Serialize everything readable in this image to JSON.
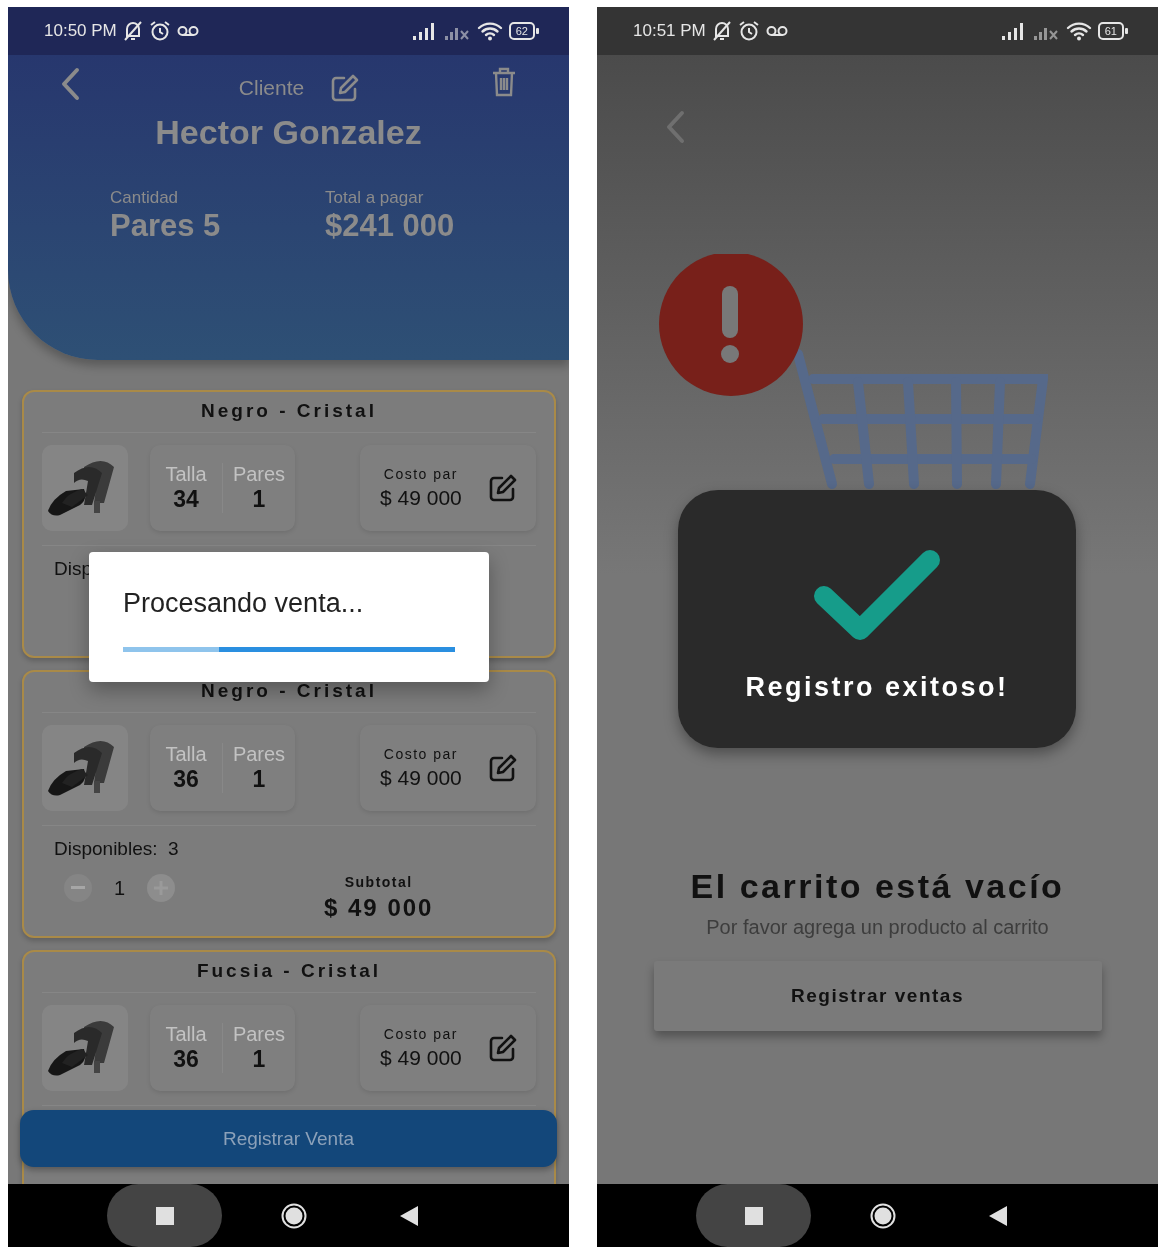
{
  "screens": [
    {
      "kind": "cart",
      "status_bar": {
        "time": "10:50 PM",
        "battery": "62"
      },
      "header": {
        "label": "Cliente",
        "customer": "Hector Gonzalez",
        "stats": [
          {
            "label": "Cantidad",
            "value": "Pares 5"
          },
          {
            "label": "Total a pagar",
            "value": "$241 000"
          }
        ]
      },
      "items": [
        {
          "title": "Negro - Cristal",
          "size_label": "Talla",
          "size": "34",
          "pairs_label": "Pares",
          "pairs": "1",
          "cost_label": "Costo par",
          "cost": "$ 49 000",
          "available": "Disp"
        },
        {
          "title": "Negro - Cristal",
          "size_label": "Talla",
          "size": "36",
          "pairs_label": "Pares",
          "pairs": "1",
          "cost_label": "Costo par",
          "cost": "$ 49 000",
          "available": "Disponibles:  3",
          "quantity": "1",
          "subtotal_label": "Subtotal",
          "subtotal": "$ 49 000"
        },
        {
          "title": "Fucsia - Cristal",
          "size_label": "Talla",
          "size": "36",
          "pairs_label": "Pares",
          "pairs": "1",
          "cost_label": "Costo par",
          "cost": "$ 49 000"
        }
      ],
      "action": "Registrar Venta",
      "dialog": {
        "message": "Procesando venta...",
        "level": 0.71
      }
    },
    {
      "kind": "empty",
      "status_bar": {
        "time": "10:51 PM",
        "battery": "61"
      },
      "toast": {
        "message": "Registro exitoso!"
      },
      "title": "El carrito está vacío",
      "subtitle": "Por favor agrega un producto al carrito",
      "action": "Registrar ventas"
    }
  ]
}
